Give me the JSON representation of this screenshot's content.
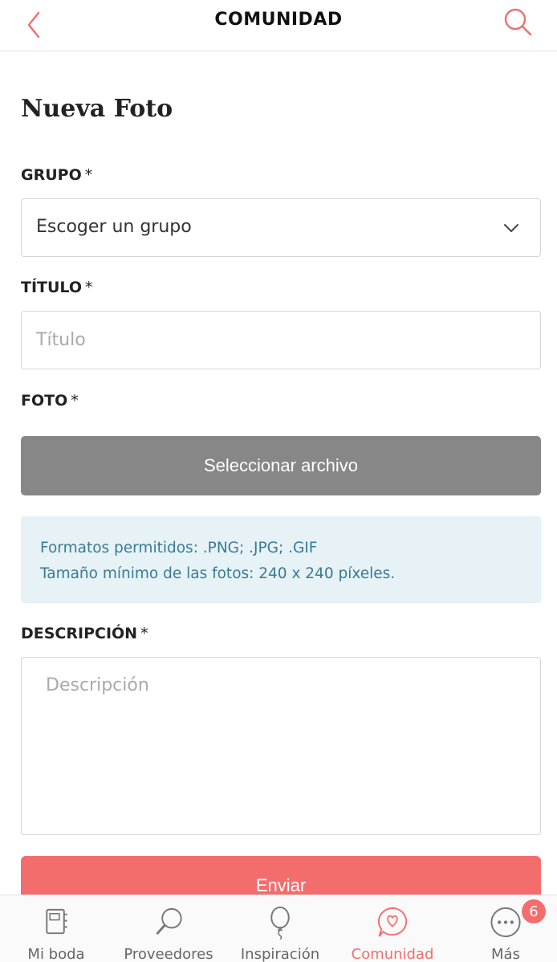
{
  "header": {
    "title": "COMUNIDAD",
    "back_icon": "chevron-left-icon",
    "search_icon": "search-icon",
    "accent_color": "#f46d6d"
  },
  "form": {
    "page_title": "Nueva Foto",
    "group": {
      "label": "GRUPO",
      "required_mark": "*",
      "selected": "Escoger un grupo"
    },
    "title": {
      "label": "TÍTULO",
      "required_mark": "*",
      "value": "",
      "placeholder": "Título"
    },
    "photo": {
      "label": "FOTO",
      "required_mark": "*",
      "button_label": "Seleccionar archivo"
    },
    "info": {
      "formats": "Formatos permitidos: .PNG; .JPG; .GIF",
      "min_size": "Tamaño mínimo de las fotos: 240 x 240 píxeles."
    },
    "description": {
      "label": "DESCRIPCIÓN",
      "required_mark": "*",
      "value": "",
      "placeholder": "Descripción"
    },
    "submit_label": "Enviar"
  },
  "tabbar": {
    "items": [
      {
        "label": "Mi boda",
        "icon": "notebook-icon",
        "active": false
      },
      {
        "label": "Proveedores",
        "icon": "magnifier-icon",
        "active": false
      },
      {
        "label": "Inspiración",
        "icon": "balloon-icon",
        "active": false
      },
      {
        "label": "Comunidad",
        "icon": "heart-chat-icon",
        "active": true
      },
      {
        "label": "Más",
        "icon": "more-icon",
        "active": false
      }
    ],
    "more_badge": "6"
  }
}
